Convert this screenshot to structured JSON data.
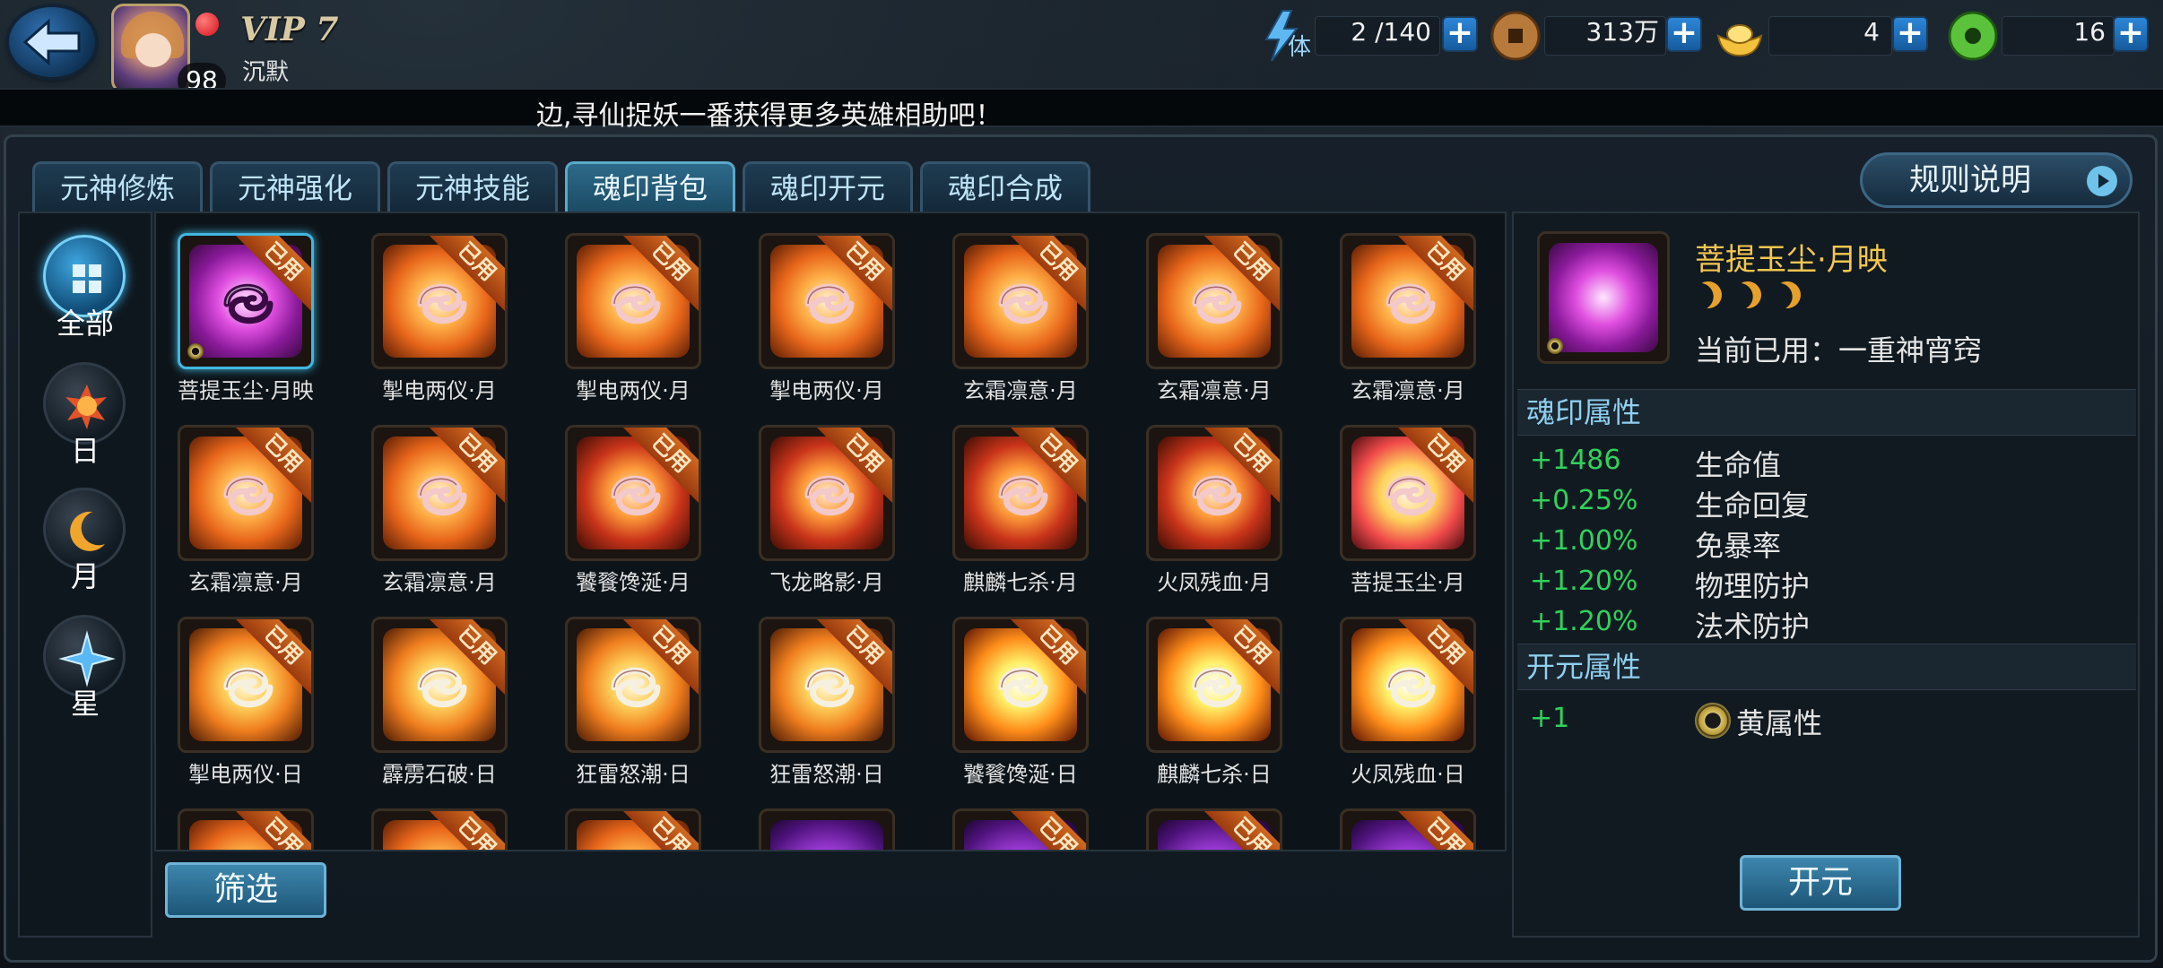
{
  "header": {
    "level": "98",
    "vip": "VIP 7",
    "username": "沉默",
    "stamina": {
      "label": "体",
      "value": "2 /140"
    },
    "coins": {
      "value": "313万"
    },
    "gold": {
      "value": "4"
    },
    "jade": {
      "value": "16"
    },
    "plus": "+"
  },
  "marquee": {
    "text": "边,寻仙捉妖一番获得更多英雄相助吧！"
  },
  "tabs": [
    {
      "label": "元神修炼"
    },
    {
      "label": "元神强化"
    },
    {
      "label": "元神技能"
    },
    {
      "label": "魂印背包",
      "active": true
    },
    {
      "label": "魂印开元"
    },
    {
      "label": "魂印合成"
    }
  ],
  "rules_button": "规则说明",
  "sidebar": {
    "items": [
      {
        "label": "全部",
        "icon": "grid-icon",
        "active": true
      },
      {
        "label": "日",
        "icon": "sun-icon"
      },
      {
        "label": "月",
        "icon": "moon-icon"
      },
      {
        "label": "星",
        "icon": "star-icon"
      }
    ]
  },
  "grid": {
    "used_label": "已用",
    "items": [
      {
        "name": "菩提玉尘·月映",
        "kind": "purple"
      },
      {
        "name": "掣电两仪·月",
        "kind": "gold"
      },
      {
        "name": "掣电两仪·月",
        "kind": "gold"
      },
      {
        "name": "掣电两仪·月",
        "kind": "gold"
      },
      {
        "name": "玄霜凛意·月",
        "kind": "gold"
      },
      {
        "name": "玄霜凛意·月",
        "kind": "gold"
      },
      {
        "name": "玄霜凛意·月",
        "kind": "gold"
      },
      {
        "name": "玄霜凛意·月",
        "kind": "gold"
      },
      {
        "name": "玄霜凛意·月",
        "kind": "gold"
      },
      {
        "name": "饕餮馋涎·月",
        "kind": "flare"
      },
      {
        "name": "飞龙略影·月",
        "kind": "flare"
      },
      {
        "name": "麒麟七杀·月",
        "kind": "flare"
      },
      {
        "name": "火凤残血·月",
        "kind": "flare"
      },
      {
        "name": "菩提玉尘·月",
        "kind": "bright"
      },
      {
        "name": "掣电两仪·日",
        "kind": "orange"
      },
      {
        "name": "霹雳石破·日",
        "kind": "orange"
      },
      {
        "name": "狂雷怒潮·日",
        "kind": "orange"
      },
      {
        "name": "狂雷怒潮·日",
        "kind": "orange"
      },
      {
        "name": "饕餮馋涎·日",
        "kind": "sunflare"
      },
      {
        "name": "麒麟七杀·日",
        "kind": "sunflare"
      },
      {
        "name": "火凤残血·日",
        "kind": "sunflare"
      },
      {
        "name": "",
        "kind": "gold"
      },
      {
        "name": "",
        "kind": "gold"
      },
      {
        "name": "",
        "kind": "gold"
      },
      {
        "name": "",
        "kind": "violet",
        "no_used": true
      },
      {
        "name": "",
        "kind": "violet"
      },
      {
        "name": "",
        "kind": "violet"
      },
      {
        "name": "",
        "kind": "violet"
      }
    ]
  },
  "filter_button": "筛选",
  "detail": {
    "title": "菩提玉尘·月映",
    "stars": 3,
    "current": "当前已用：一重神宵窍",
    "section_attr": "魂印属性",
    "attributes": [
      {
        "value": "+1486",
        "name": "生命值"
      },
      {
        "value": "+0.25%",
        "name": "生命回复"
      },
      {
        "value": "+1.00%",
        "name": "免暴率"
      },
      {
        "value": "+1.20%",
        "name": "物理防护"
      },
      {
        "value": "+1.20%",
        "name": "法术防护"
      }
    ],
    "section_open": "开元属性",
    "open_attr": {
      "value": "+1",
      "name": "黄属性"
    },
    "open_button": "开元"
  },
  "colors": {
    "accent": "#41b7e0",
    "title_gold": "#f4c74f",
    "stat_green": "#2fd25b",
    "used_orange": "#c45a18"
  }
}
